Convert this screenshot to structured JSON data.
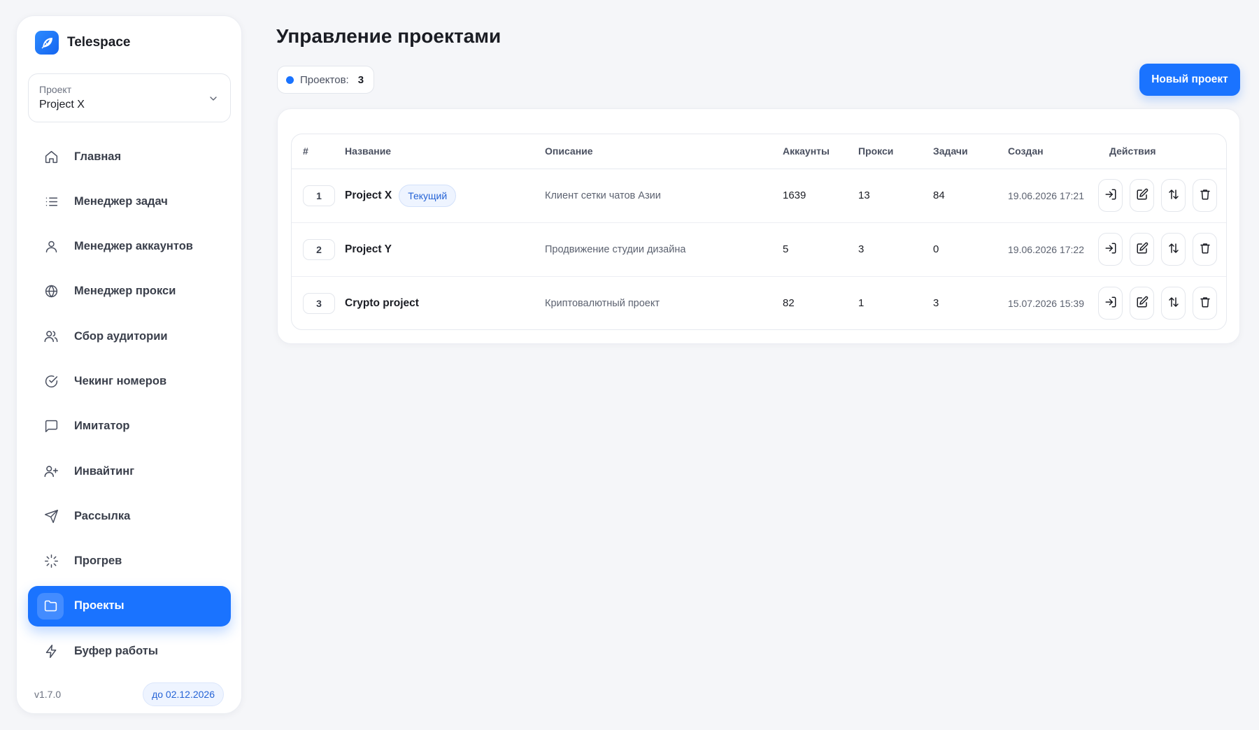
{
  "brand": {
    "name": "Telespace"
  },
  "project_select": {
    "label": "Проект",
    "value": "Project X"
  },
  "sidebar": {
    "items": [
      {
        "label": "Главная",
        "icon": "home-icon"
      },
      {
        "label": "Менеджер задач",
        "icon": "list-icon"
      },
      {
        "label": "Менеджер аккаунтов",
        "icon": "user-icon"
      },
      {
        "label": "Менеджер прокси",
        "icon": "globe-icon"
      },
      {
        "label": "Сбор аудитории",
        "icon": "users-icon"
      },
      {
        "label": "Чекинг номеров",
        "icon": "check-circle-icon"
      },
      {
        "label": "Имитатор",
        "icon": "message-square-icon"
      },
      {
        "label": "Инвайтинг",
        "icon": "user-plus-icon"
      },
      {
        "label": "Рассылка",
        "icon": "send-icon"
      },
      {
        "label": "Прогрев",
        "icon": "loader-icon"
      },
      {
        "label": "Проекты",
        "icon": "folder-icon",
        "active": true
      },
      {
        "label": "Буфер работы",
        "icon": "zap-icon"
      }
    ],
    "version": "v1.7.0",
    "license": "до 02.12.2026"
  },
  "main": {
    "title": "Управление проектами",
    "count_label": "Проектов:",
    "count_value": "3",
    "new_button": "Новый проект",
    "table": {
      "headers": {
        "idx": "#",
        "name": "Название",
        "description": "Описание",
        "accounts": "Аккаунты",
        "proxies": "Прокси",
        "tasks": "Задачи",
        "created": "Создан",
        "actions": "Действия"
      },
      "current_badge": "Текущий",
      "rows": [
        {
          "idx": "1",
          "name": "Project X",
          "current": true,
          "description": "Клиент сетки чатов Азии",
          "accounts": "1639",
          "proxies": "13",
          "tasks": "84",
          "created": "19.06.2026 17:21"
        },
        {
          "idx": "2",
          "name": "Project Y",
          "current": false,
          "description": "Продвижение студии дизайна",
          "accounts": "5",
          "proxies": "3",
          "tasks": "0",
          "created": "19.06.2026 17:22"
        },
        {
          "idx": "3",
          "name": "Crypto project",
          "current": false,
          "description": "Криптовалютный проект",
          "accounts": "82",
          "proxies": "1",
          "tasks": "3",
          "created": "15.07.2026 15:39"
        }
      ],
      "row_action_icons": [
        "enter-icon",
        "edit-icon",
        "swap-icon",
        "trash-icon"
      ]
    }
  },
  "colors": {
    "accent": "#1a73ff",
    "background": "#f5f6f9",
    "badge_text": "#2563d6"
  }
}
